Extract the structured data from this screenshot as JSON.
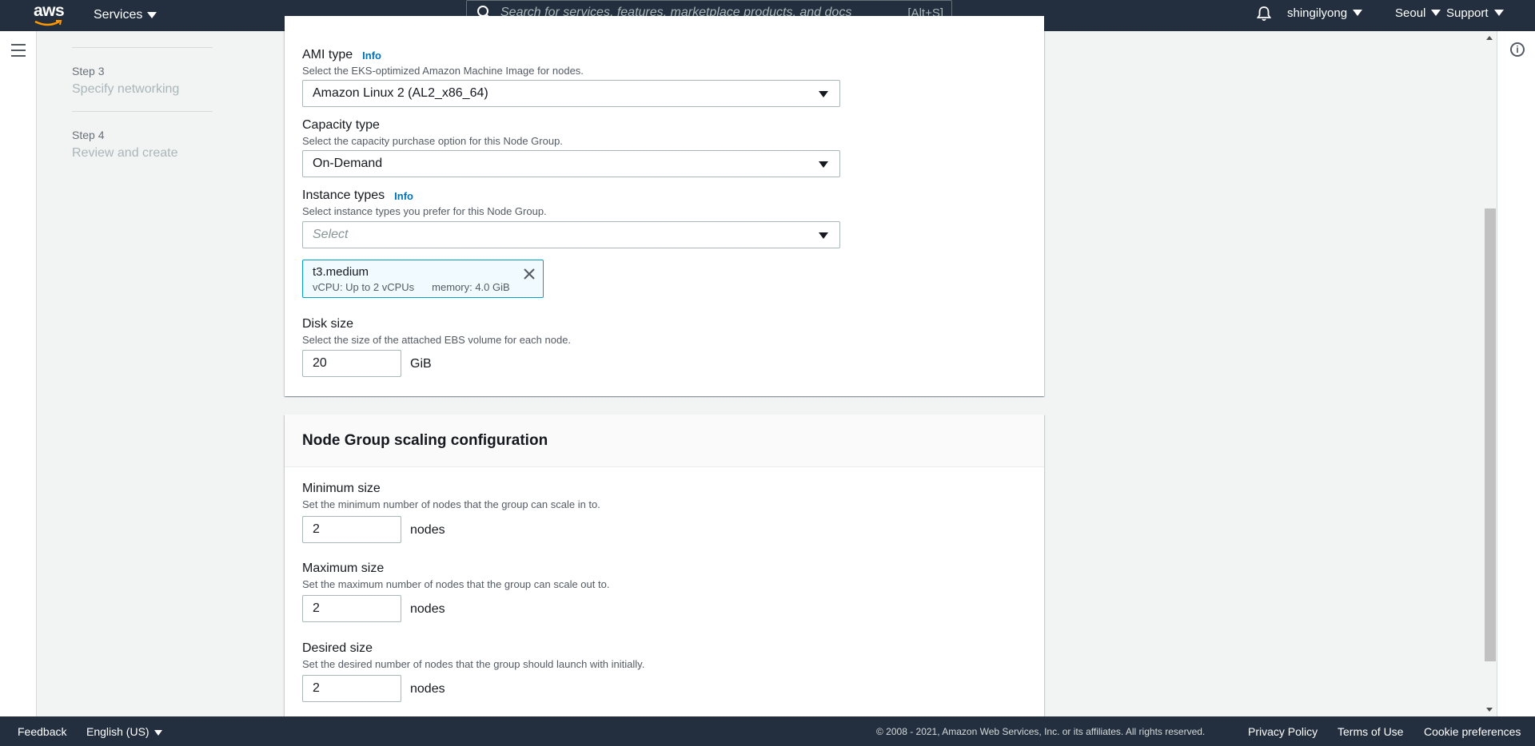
{
  "topnav": {
    "logo": "aws",
    "services_label": "Services",
    "search_placeholder": "Search for services, features, marketplace products, and docs",
    "search_shortcut": "[Alt+S]",
    "user": "shingilyong",
    "region": "Seoul",
    "support": "Support"
  },
  "steps": [
    {
      "num": "Step 3",
      "title": "Specify networking"
    },
    {
      "num": "Step 4",
      "title": "Review and create"
    }
  ],
  "compute": {
    "ami": {
      "label": "AMI type",
      "info": "Info",
      "desc": "Select the EKS-optimized Amazon Machine Image for nodes.",
      "value": "Amazon Linux 2 (AL2_x86_64)"
    },
    "capacity": {
      "label": "Capacity type",
      "desc": "Select the capacity purchase option for this Node Group.",
      "value": "On-Demand"
    },
    "instance": {
      "label": "Instance types",
      "info": "Info",
      "desc": "Select instance types you prefer for this Node Group.",
      "placeholder": "Select",
      "token": {
        "name": "t3.medium",
        "vcpu": "vCPU: Up to 2 vCPUs",
        "memory": "memory: 4.0 GiB"
      }
    },
    "disk": {
      "label": "Disk size",
      "desc": "Select the size of the attached EBS volume for each node.",
      "value": "20",
      "unit": "GiB"
    }
  },
  "scaling": {
    "title": "Node Group scaling configuration",
    "min": {
      "label": "Minimum size",
      "desc": "Set the minimum number of nodes that the group can scale in to.",
      "value": "2",
      "unit": "nodes"
    },
    "max": {
      "label": "Maximum size",
      "desc": "Set the maximum number of nodes that the group can scale out to.",
      "value": "2",
      "unit": "nodes"
    },
    "desired": {
      "label": "Desired size",
      "desc": "Set the desired number of nodes that the group should launch with initially.",
      "value": "2",
      "unit": "nodes"
    }
  },
  "footer": {
    "feedback": "Feedback",
    "language": "English (US)",
    "copyright": "© 2008 - 2021, Amazon Web Services, Inc. or its affiliates. All rights reserved.",
    "privacy": "Privacy Policy",
    "terms": "Terms of Use",
    "cookies": "Cookie preferences"
  },
  "colors": {
    "nav_bg": "#232f3e",
    "link": "#0073bb",
    "token_border": "#00a1c9",
    "token_bg": "#f1faff"
  }
}
